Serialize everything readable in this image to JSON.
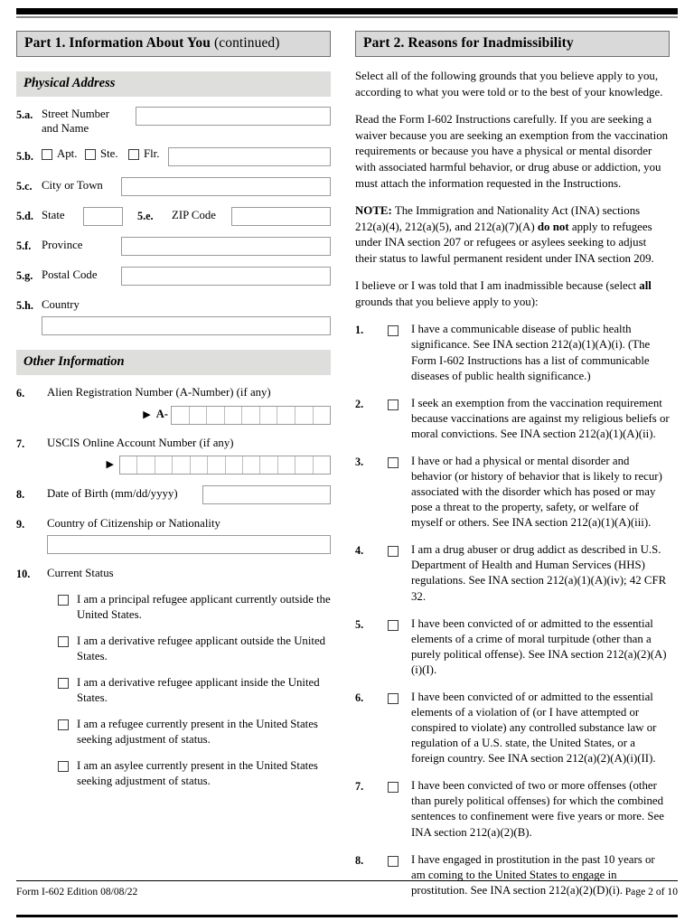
{
  "part1": {
    "header_title": "Part 1.  Information About You",
    "header_continued": "(continued)",
    "physical_address_band": "Physical Address",
    "fields": {
      "f5a_num": "5.a.",
      "f5a_label_line1": "Street Number",
      "f5a_label_line2": "and Name",
      "f5b_num": "5.b.",
      "f5b_opt1": "Apt.",
      "f5b_opt2": "Ste.",
      "f5b_opt3": "Flr.",
      "f5c_num": "5.c.",
      "f5c_label": "City or Town",
      "f5d_num": "5.d.",
      "f5d_label": "State",
      "f5e_num": "5.e.",
      "f5e_label": "ZIP Code",
      "f5f_num": "5.f.",
      "f5f_label": "Province",
      "f5g_num": "5.g.",
      "f5g_label": "Postal Code",
      "f5h_num": "5.h.",
      "f5h_label": "Country"
    },
    "other_information_band": "Other Information",
    "item6": {
      "num": "6.",
      "label": "Alien Registration Number (A-Number) (if any)",
      "prefix": "A-",
      "cells": 9
    },
    "item7": {
      "num": "7.",
      "label": "USCIS Online Account Number (if any)",
      "cells": 12
    },
    "item8": {
      "num": "8.",
      "label": "Date of Birth (mm/dd/yyyy)"
    },
    "item9": {
      "num": "9.",
      "label": "Country of Citizenship or Nationality"
    },
    "item10": {
      "num": "10.",
      "label": "Current Status",
      "options": [
        "I am a principal refugee applicant currently outside the United States.",
        "I am a derivative refugee applicant outside the United States.",
        "I am a derivative refugee applicant inside the United States.",
        "I am a refugee currently present in the United States seeking adjustment of status.",
        "I am an asylee currently present in the United States seeking adjustment of status."
      ]
    }
  },
  "part2": {
    "header_title": "Part 2.  Reasons for Inadmissibility",
    "intro1": "Select all of the following grounds that you believe apply to you, according to what you were told or to the best of your knowledge.",
    "intro2": "Read the Form I-602 Instructions carefully.  If you are seeking a waiver because you are seeking an exemption from the vaccination requirements or because you have a physical or mental disorder with associated harmful behavior, or drug abuse or addiction, you must attach the information requested in the Instructions.",
    "note_label": "NOTE:",
    "note_text_a": "  The Immigration and Nationality Act (INA) sections 212(a)(4), 212(a)(5), and 212(a)(7)(A) ",
    "note_bold": "do not",
    "note_text_b": " apply to refugees under INA section 207 or refugees or asylees seeking to adjust their status to lawful permanent resident under INA section 209.",
    "believe_a": "I believe or I was told that I am inadmissible because (select ",
    "believe_bold": "all",
    "believe_b": " grounds that you believe apply to you):",
    "grounds": [
      {
        "num": "1.",
        "text": "I have a communicable disease of public health significance.  See INA section 212(a)(1)(A)(i).  (The Form I-602 Instructions has a list of communicable diseases of public health significance.)"
      },
      {
        "num": "2.",
        "text": "I seek an exemption from the vaccination requirement because vaccinations are against my religious beliefs or moral convictions.  See INA section 212(a)(1)(A)(ii)."
      },
      {
        "num": "3.",
        "text": "I have or had a physical or mental disorder and behavior (or history of behavior that is likely to recur) associated with the disorder which has posed or may pose a threat to the property, safety, or welfare of myself or others. See INA section 212(a)(1)(A)(iii)."
      },
      {
        "num": "4.",
        "text": "I am a drug abuser or drug addict as described in U.S. Department of Health and Human Services (HHS) regulations.  See INA section 212(a)(1)(A)(iv); 42 CFR 32."
      },
      {
        "num": "5.",
        "text": "I have been convicted of or admitted to the essential elements of a crime of moral turpitude (other than a purely political offense).  See INA section 212(a)(2)(A)(i)(I)."
      },
      {
        "num": "6.",
        "text": "I have been convicted of or admitted to the essential elements of a violation of (or I have attempted or conspired to violate) any controlled substance law or regulation of a U.S. state, the United States, or a foreign country.  See INA section 212(a)(2)(A)(i)(II)."
      },
      {
        "num": "7.",
        "text": "I have been convicted of two or more offenses (other than purely political offenses) for which the combined sentences to confinement were five years or more.  See INA section 212(a)(2)(B)."
      },
      {
        "num": "8.",
        "text": "I have engaged in prostitution in the past 10 years or am coming to the United States to engage in prostitution.  See INA section 212(a)(2)(D)(i)."
      }
    ]
  },
  "footer": {
    "form_info": "Form I-602   Edition   08/08/22",
    "page_info": "Page 2 of 10"
  }
}
